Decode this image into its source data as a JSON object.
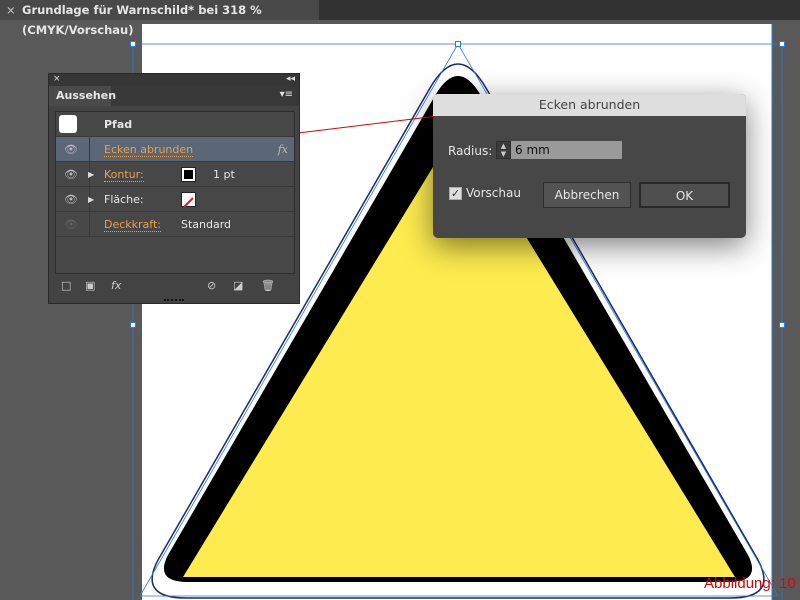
{
  "document_tab": {
    "title": "Grundlage für Warnschild* bei 318 % (CMYK/Vorschau)",
    "close": "×"
  },
  "appearance_panel": {
    "title": "Aussehen",
    "close": "×",
    "collapse": "◂◂",
    "menu": "▾≡",
    "rows": [
      {
        "label": "Pfad"
      },
      {
        "label": "Ecken abrunden",
        "fx": "fx"
      },
      {
        "label": "Kontur:",
        "value": "1 pt"
      },
      {
        "label": "Fläche:"
      },
      {
        "label": "Deckkraft:",
        "value": "Standard"
      }
    ],
    "fx_menu": "fx"
  },
  "dialog": {
    "title": "Ecken abrunden",
    "radius_label": "Radius:",
    "radius_value": "6 mm",
    "preview_label": "Vorschau",
    "preview_checked": true,
    "cancel": "Abbrechen",
    "ok": "OK"
  },
  "caption": "Abbildung: 10",
  "colors": {
    "fill_yellow": "#fdeb4f",
    "annotation_red": "#e10000",
    "selection_blue": "#2a7bd4"
  }
}
